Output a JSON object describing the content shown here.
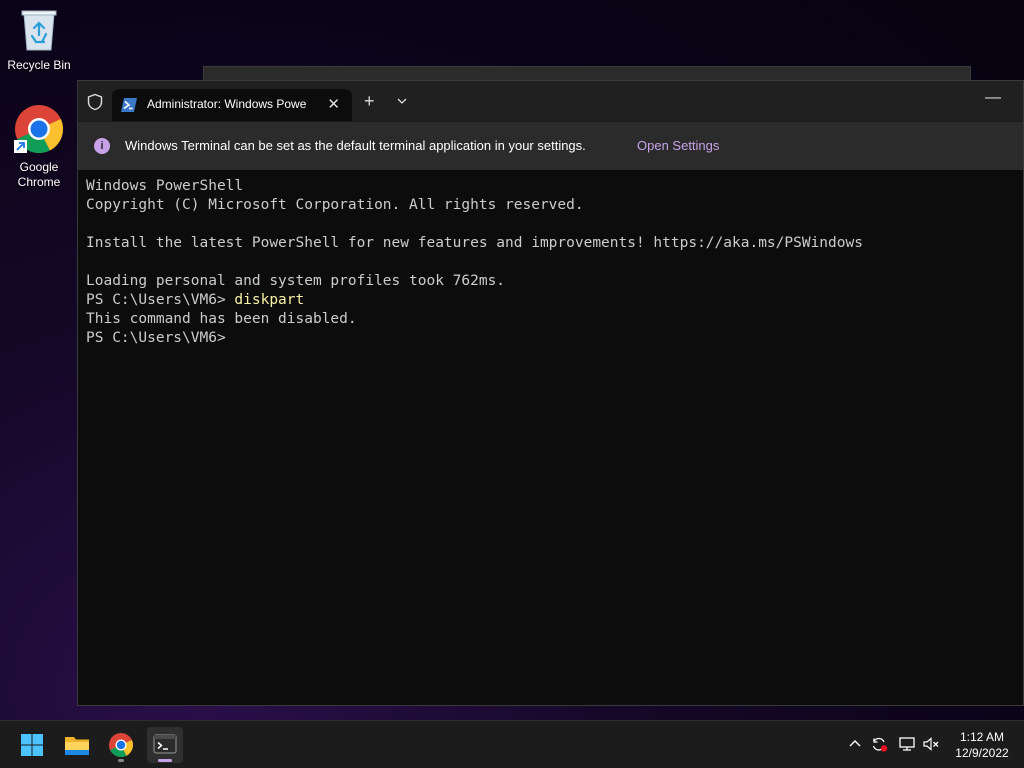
{
  "desktop": {
    "icons": [
      {
        "label": "Recycle Bin"
      },
      {
        "label": "Google\nChrome"
      }
    ]
  },
  "terminal": {
    "tab_title": "Administrator: Windows Powe",
    "tab_close": "✕",
    "new_tab": "+",
    "minimize": "—",
    "infobar": {
      "message": "Windows Terminal can be set as the default terminal application in your settings.",
      "link": "Open Settings"
    },
    "console": {
      "lines": [
        "Windows PowerShell",
        "Copyright (C) Microsoft Corporation. All rights reserved.",
        "",
        "Install the latest PowerShell for new features and improvements! https://aka.ms/PSWindows",
        "",
        "Loading personal and system profiles took 762ms."
      ],
      "prompt1": "PS C:\\Users\\VM6> ",
      "command": "diskpart",
      "output": "This command has been disabled.",
      "prompt2": "PS C:\\Users\\VM6>"
    }
  },
  "taskbar": {
    "apps": [
      {
        "name": "start",
        "icon": "windows-logo-icon"
      },
      {
        "name": "file-explorer",
        "icon": "folder-icon"
      },
      {
        "name": "chrome",
        "icon": "chrome-icon"
      },
      {
        "name": "terminal",
        "icon": "terminal-icon"
      }
    ],
    "tray": {
      "icons": [
        "chevron-up-icon",
        "sync-icon",
        "network-icon",
        "volume-muted-icon"
      ]
    },
    "clock": {
      "time": "1:12 AM",
      "date": "12/9/2022"
    }
  },
  "colors": {
    "accent": "#c8a2e8",
    "console_text": "#cccccc",
    "command_text": "#f9f1a5"
  }
}
